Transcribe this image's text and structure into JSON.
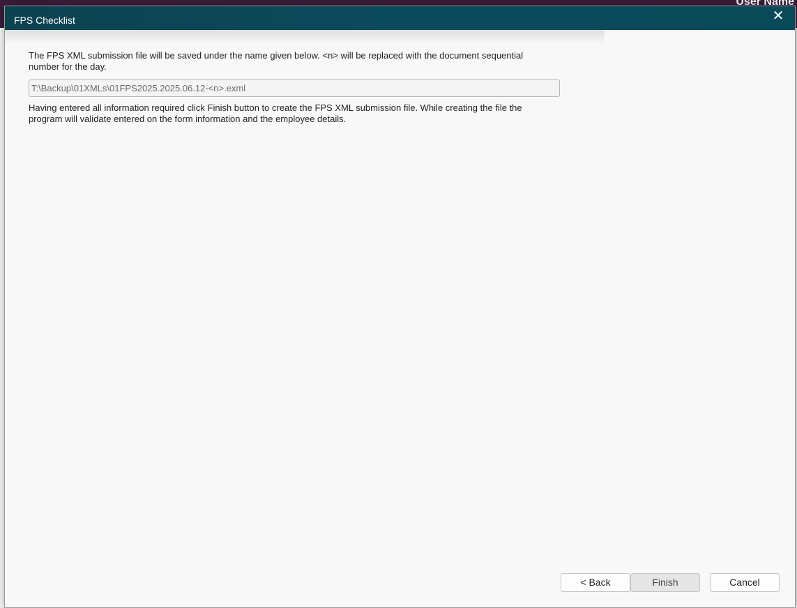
{
  "background": {
    "user_name": "User Name"
  },
  "dialog": {
    "title": "FPS Checklist",
    "close_glyph": "✕",
    "intro_text": "The FPS XML submission file will be saved under the name given below. <n> will be replaced with the document sequential number for the day.",
    "file_name_value": "T:\\Backup\\01XMLs\\01FPS2025.2025.06.12-<n>.exml",
    "instruction_text": "Having entered all information required click Finish button to create the FPS XML submission file. While creating the file the program will validate entered on the form information and the employee details.",
    "buttons": {
      "back": "< Back",
      "finish": "Finish",
      "cancel": "Cancel"
    }
  },
  "colors": {
    "titlebar": "#0b4a5c",
    "dialog_bg": "#f8f8f8"
  }
}
